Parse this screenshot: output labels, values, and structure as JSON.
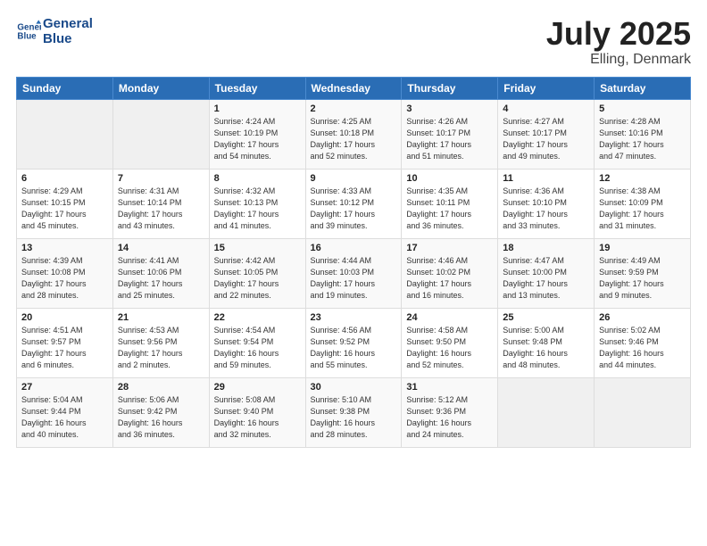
{
  "header": {
    "logo_line1": "General",
    "logo_line2": "Blue",
    "month": "July 2025",
    "location": "Elling, Denmark"
  },
  "days_of_week": [
    "Sunday",
    "Monday",
    "Tuesday",
    "Wednesday",
    "Thursday",
    "Friday",
    "Saturday"
  ],
  "weeks": [
    [
      {
        "num": "",
        "info": ""
      },
      {
        "num": "",
        "info": ""
      },
      {
        "num": "1",
        "info": "Sunrise: 4:24 AM\nSunset: 10:19 PM\nDaylight: 17 hours\nand 54 minutes."
      },
      {
        "num": "2",
        "info": "Sunrise: 4:25 AM\nSunset: 10:18 PM\nDaylight: 17 hours\nand 52 minutes."
      },
      {
        "num": "3",
        "info": "Sunrise: 4:26 AM\nSunset: 10:17 PM\nDaylight: 17 hours\nand 51 minutes."
      },
      {
        "num": "4",
        "info": "Sunrise: 4:27 AM\nSunset: 10:17 PM\nDaylight: 17 hours\nand 49 minutes."
      },
      {
        "num": "5",
        "info": "Sunrise: 4:28 AM\nSunset: 10:16 PM\nDaylight: 17 hours\nand 47 minutes."
      }
    ],
    [
      {
        "num": "6",
        "info": "Sunrise: 4:29 AM\nSunset: 10:15 PM\nDaylight: 17 hours\nand 45 minutes."
      },
      {
        "num": "7",
        "info": "Sunrise: 4:31 AM\nSunset: 10:14 PM\nDaylight: 17 hours\nand 43 minutes."
      },
      {
        "num": "8",
        "info": "Sunrise: 4:32 AM\nSunset: 10:13 PM\nDaylight: 17 hours\nand 41 minutes."
      },
      {
        "num": "9",
        "info": "Sunrise: 4:33 AM\nSunset: 10:12 PM\nDaylight: 17 hours\nand 39 minutes."
      },
      {
        "num": "10",
        "info": "Sunrise: 4:35 AM\nSunset: 10:11 PM\nDaylight: 17 hours\nand 36 minutes."
      },
      {
        "num": "11",
        "info": "Sunrise: 4:36 AM\nSunset: 10:10 PM\nDaylight: 17 hours\nand 33 minutes."
      },
      {
        "num": "12",
        "info": "Sunrise: 4:38 AM\nSunset: 10:09 PM\nDaylight: 17 hours\nand 31 minutes."
      }
    ],
    [
      {
        "num": "13",
        "info": "Sunrise: 4:39 AM\nSunset: 10:08 PM\nDaylight: 17 hours\nand 28 minutes."
      },
      {
        "num": "14",
        "info": "Sunrise: 4:41 AM\nSunset: 10:06 PM\nDaylight: 17 hours\nand 25 minutes."
      },
      {
        "num": "15",
        "info": "Sunrise: 4:42 AM\nSunset: 10:05 PM\nDaylight: 17 hours\nand 22 minutes."
      },
      {
        "num": "16",
        "info": "Sunrise: 4:44 AM\nSunset: 10:03 PM\nDaylight: 17 hours\nand 19 minutes."
      },
      {
        "num": "17",
        "info": "Sunrise: 4:46 AM\nSunset: 10:02 PM\nDaylight: 17 hours\nand 16 minutes."
      },
      {
        "num": "18",
        "info": "Sunrise: 4:47 AM\nSunset: 10:00 PM\nDaylight: 17 hours\nand 13 minutes."
      },
      {
        "num": "19",
        "info": "Sunrise: 4:49 AM\nSunset: 9:59 PM\nDaylight: 17 hours\nand 9 minutes."
      }
    ],
    [
      {
        "num": "20",
        "info": "Sunrise: 4:51 AM\nSunset: 9:57 PM\nDaylight: 17 hours\nand 6 minutes."
      },
      {
        "num": "21",
        "info": "Sunrise: 4:53 AM\nSunset: 9:56 PM\nDaylight: 17 hours\nand 2 minutes."
      },
      {
        "num": "22",
        "info": "Sunrise: 4:54 AM\nSunset: 9:54 PM\nDaylight: 16 hours\nand 59 minutes."
      },
      {
        "num": "23",
        "info": "Sunrise: 4:56 AM\nSunset: 9:52 PM\nDaylight: 16 hours\nand 55 minutes."
      },
      {
        "num": "24",
        "info": "Sunrise: 4:58 AM\nSunset: 9:50 PM\nDaylight: 16 hours\nand 52 minutes."
      },
      {
        "num": "25",
        "info": "Sunrise: 5:00 AM\nSunset: 9:48 PM\nDaylight: 16 hours\nand 48 minutes."
      },
      {
        "num": "26",
        "info": "Sunrise: 5:02 AM\nSunset: 9:46 PM\nDaylight: 16 hours\nand 44 minutes."
      }
    ],
    [
      {
        "num": "27",
        "info": "Sunrise: 5:04 AM\nSunset: 9:44 PM\nDaylight: 16 hours\nand 40 minutes."
      },
      {
        "num": "28",
        "info": "Sunrise: 5:06 AM\nSunset: 9:42 PM\nDaylight: 16 hours\nand 36 minutes."
      },
      {
        "num": "29",
        "info": "Sunrise: 5:08 AM\nSunset: 9:40 PM\nDaylight: 16 hours\nand 32 minutes."
      },
      {
        "num": "30",
        "info": "Sunrise: 5:10 AM\nSunset: 9:38 PM\nDaylight: 16 hours\nand 28 minutes."
      },
      {
        "num": "31",
        "info": "Sunrise: 5:12 AM\nSunset: 9:36 PM\nDaylight: 16 hours\nand 24 minutes."
      },
      {
        "num": "",
        "info": ""
      },
      {
        "num": "",
        "info": ""
      }
    ]
  ]
}
